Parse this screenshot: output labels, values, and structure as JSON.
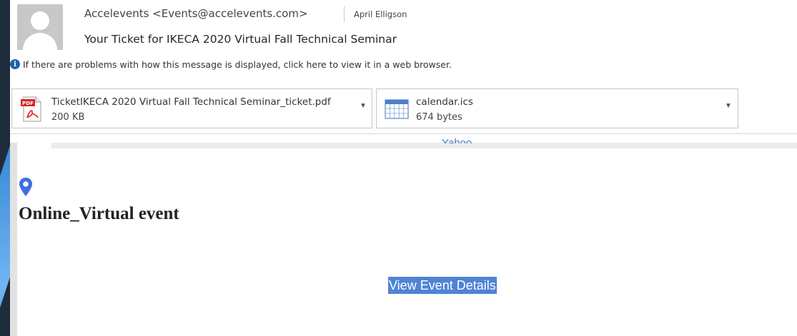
{
  "email": {
    "from": "Accelevents <Events@accelevents.com>",
    "to": "April Elligson",
    "subject": "Your Ticket for IKECA 2020 Virtual Fall Technical Seminar",
    "info_message": "If there are problems with how this message is displayed, click here to view it in a web browser."
  },
  "attachments": [
    {
      "name": "TicketIKECA 2020 Virtual Fall Technical Seminar_ticket.pdf",
      "size": "200 KB",
      "icon": "pdf-icon"
    },
    {
      "name": "calendar.ics",
      "size": "674 bytes",
      "icon": "calendar-icon"
    }
  ],
  "body": {
    "cut_text": "Yahoo",
    "location": "Online_Virtual event",
    "button_label": "View Event Details"
  },
  "colors": {
    "accent": "#4f83d6",
    "info_icon": "#1f62b3",
    "pin": "#3f6fe0"
  }
}
